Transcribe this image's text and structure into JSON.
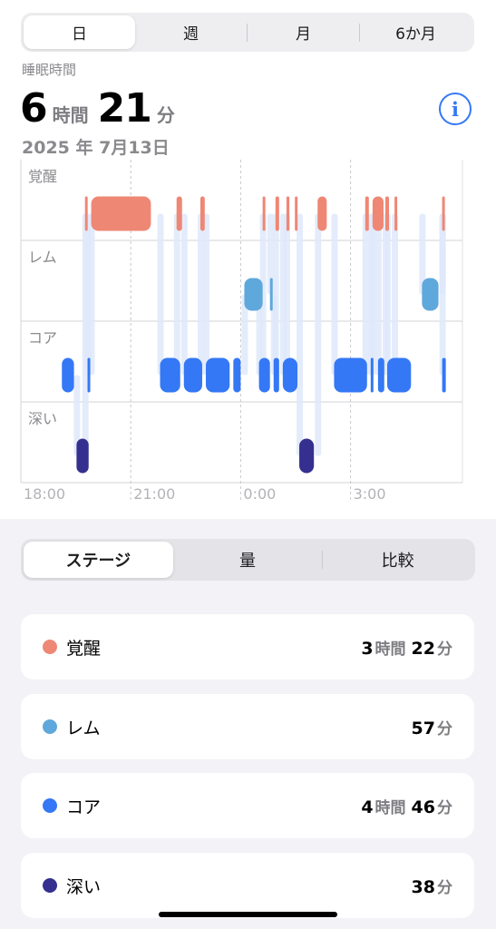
{
  "tabs": [
    {
      "label": "日",
      "active": true
    },
    {
      "label": "週",
      "active": false
    },
    {
      "label": "月",
      "active": false
    },
    {
      "label": "6か月",
      "active": false
    }
  ],
  "summary": {
    "label": "睡眠時間",
    "hours": "6",
    "hours_unit": "時間",
    "minutes": "21",
    "minutes_unit": "分",
    "date": "2025 年 7月13日"
  },
  "info_icon": "i",
  "chart_data": {
    "type": "sleep-stages",
    "stages": [
      "覚醒",
      "レム",
      "コア",
      "深い"
    ],
    "time_labels": [
      "18:00",
      "21:00",
      "0:00",
      "3:00"
    ],
    "x_unit": "hours since 18:00",
    "colors": {
      "覚醒": "#ef8775",
      "レム": "#5fa8dc",
      "コア": "#3478f6",
      "深い": "#35308f"
    },
    "segments": [
      {
        "stage": "コア",
        "start": 1.12,
        "end": 1.45
      },
      {
        "stage": "覚醒",
        "start": 1.75,
        "end": 1.78
      },
      {
        "stage": "コア",
        "start": 1.82,
        "end": 1.86
      },
      {
        "stage": "深い",
        "start": 1.52,
        "end": 1.85
      },
      {
        "stage": "覚醒",
        "start": 1.92,
        "end": 3.55
      },
      {
        "stage": "コア",
        "start": 3.8,
        "end": 4.35
      },
      {
        "stage": "覚醒",
        "start": 4.25,
        "end": 4.4
      },
      {
        "stage": "コア",
        "start": 4.45,
        "end": 4.95
      },
      {
        "stage": "覚醒",
        "start": 4.9,
        "end": 5.02
      },
      {
        "stage": "コア",
        "start": 5.05,
        "end": 5.7
      },
      {
        "stage": "コア",
        "start": 5.8,
        "end": 6.0
      },
      {
        "stage": "レム",
        "start": 6.1,
        "end": 6.6
      },
      {
        "stage": "レム",
        "start": 6.8,
        "end": 6.86
      },
      {
        "stage": "コア",
        "start": 6.5,
        "end": 6.8
      },
      {
        "stage": "覚醒",
        "start": 6.6,
        "end": 6.66
      },
      {
        "stage": "コア",
        "start": 6.9,
        "end": 7.05
      },
      {
        "stage": "覚醒",
        "start": 6.95,
        "end": 7.05
      },
      {
        "stage": "コア",
        "start": 7.15,
        "end": 7.55
      },
      {
        "stage": "覚醒",
        "start": 7.25,
        "end": 7.33
      },
      {
        "stage": "覚醒",
        "start": 7.48,
        "end": 7.54
      },
      {
        "stage": "深い",
        "start": 7.6,
        "end": 8.0
      },
      {
        "stage": "覚醒",
        "start": 8.1,
        "end": 8.35
      },
      {
        "stage": "コア",
        "start": 8.55,
        "end": 9.45
      },
      {
        "stage": "コア",
        "start": 9.55,
        "end": 9.6
      },
      {
        "stage": "覚醒",
        "start": 9.4,
        "end": 9.5
      },
      {
        "stage": "覚醒",
        "start": 9.6,
        "end": 9.9
      },
      {
        "stage": "覚醒",
        "start": 9.95,
        "end": 10.05
      },
      {
        "stage": "コア",
        "start": 9.75,
        "end": 9.92
      },
      {
        "stage": "コア",
        "start": 10.0,
        "end": 10.65
      },
      {
        "stage": "覚醒",
        "start": 10.2,
        "end": 10.25
      },
      {
        "stage": "レム",
        "start": 10.95,
        "end": 11.4
      },
      {
        "stage": "覚醒",
        "start": 11.5,
        "end": 11.55
      },
      {
        "stage": "コア",
        "start": 11.5,
        "end": 11.6
      }
    ]
  },
  "view_tabs": [
    {
      "label": "ステージ",
      "active": true
    },
    {
      "label": "量",
      "active": false
    },
    {
      "label": "比較",
      "active": false
    }
  ],
  "stage_rows": [
    {
      "label": "覚醒",
      "color": "#ef8775",
      "value": [
        {
          "n": "3",
          "u": "時間"
        },
        {
          "n": "22",
          "u": "分"
        }
      ]
    },
    {
      "label": "レム",
      "color": "#5fa8dc",
      "value": [
        {
          "n": "57",
          "u": "分"
        }
      ]
    },
    {
      "label": "コア",
      "color": "#3478f6",
      "value": [
        {
          "n": "4",
          "u": "時間"
        },
        {
          "n": "46",
          "u": "分"
        }
      ]
    },
    {
      "label": "深い",
      "color": "#35308f",
      "value": [
        {
          "n": "38",
          "u": "分"
        }
      ]
    }
  ]
}
